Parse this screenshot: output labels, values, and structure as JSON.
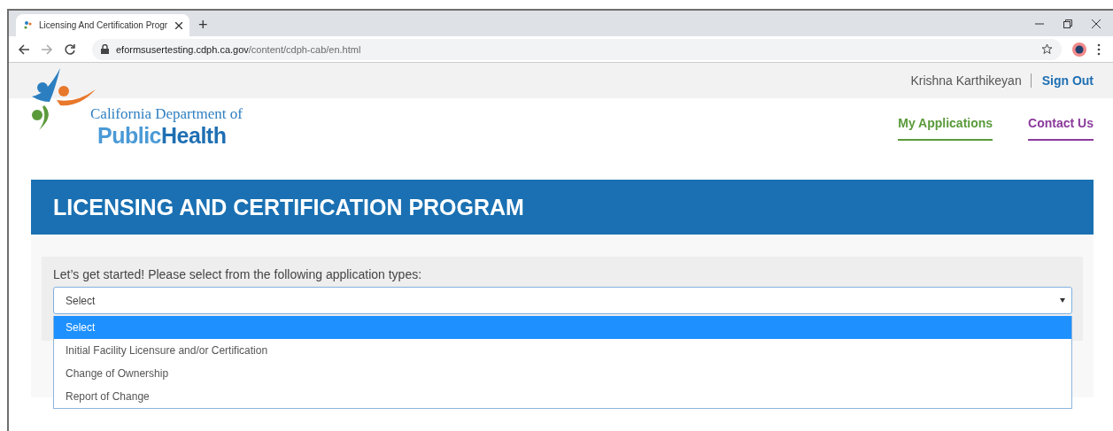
{
  "browser": {
    "tab_title": "Licensing And Certification Progr",
    "new_tab": "+",
    "address_domain": "eformsusertesting.cdph.ca.gov",
    "address_path": "/content/cdph-cab/en.html"
  },
  "header": {
    "user_name": "Krishna Karthikeyan",
    "sign_out": "Sign Out",
    "logo": {
      "line1": "California Department of",
      "word1": "Public",
      "word2": "Health"
    },
    "nav": [
      {
        "label": "My Applications",
        "color": "#5b9a3b"
      },
      {
        "label": "Contact Us",
        "color": "#8b3a9c"
      }
    ]
  },
  "banner": {
    "title": "LICENSING AND CERTIFICATION PROGRAM"
  },
  "form": {
    "prompt": "Let’s get started! Please select from the following application types:",
    "select_value": "Select",
    "expanded": true,
    "options": [
      {
        "label": "Select",
        "selected": true
      },
      {
        "label": "Initial Facility Licensure and/or Certification",
        "selected": false
      },
      {
        "label": "Change of Ownership",
        "selected": false
      },
      {
        "label": "Report of Change",
        "selected": false
      }
    ]
  }
}
